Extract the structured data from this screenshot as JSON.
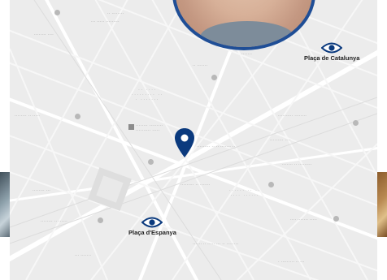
{
  "map": {
    "markers": [
      {
        "label": "Plaça de Catalunya",
        "icon": "eye-icon"
      },
      {
        "label": "Plaça d'Espanya",
        "icon": "eye-icon"
      }
    ],
    "location_pin": {
      "icon": "map-pin-icon",
      "color": "#0b3a7e"
    },
    "avatar_border_color": "#1f4e96"
  }
}
